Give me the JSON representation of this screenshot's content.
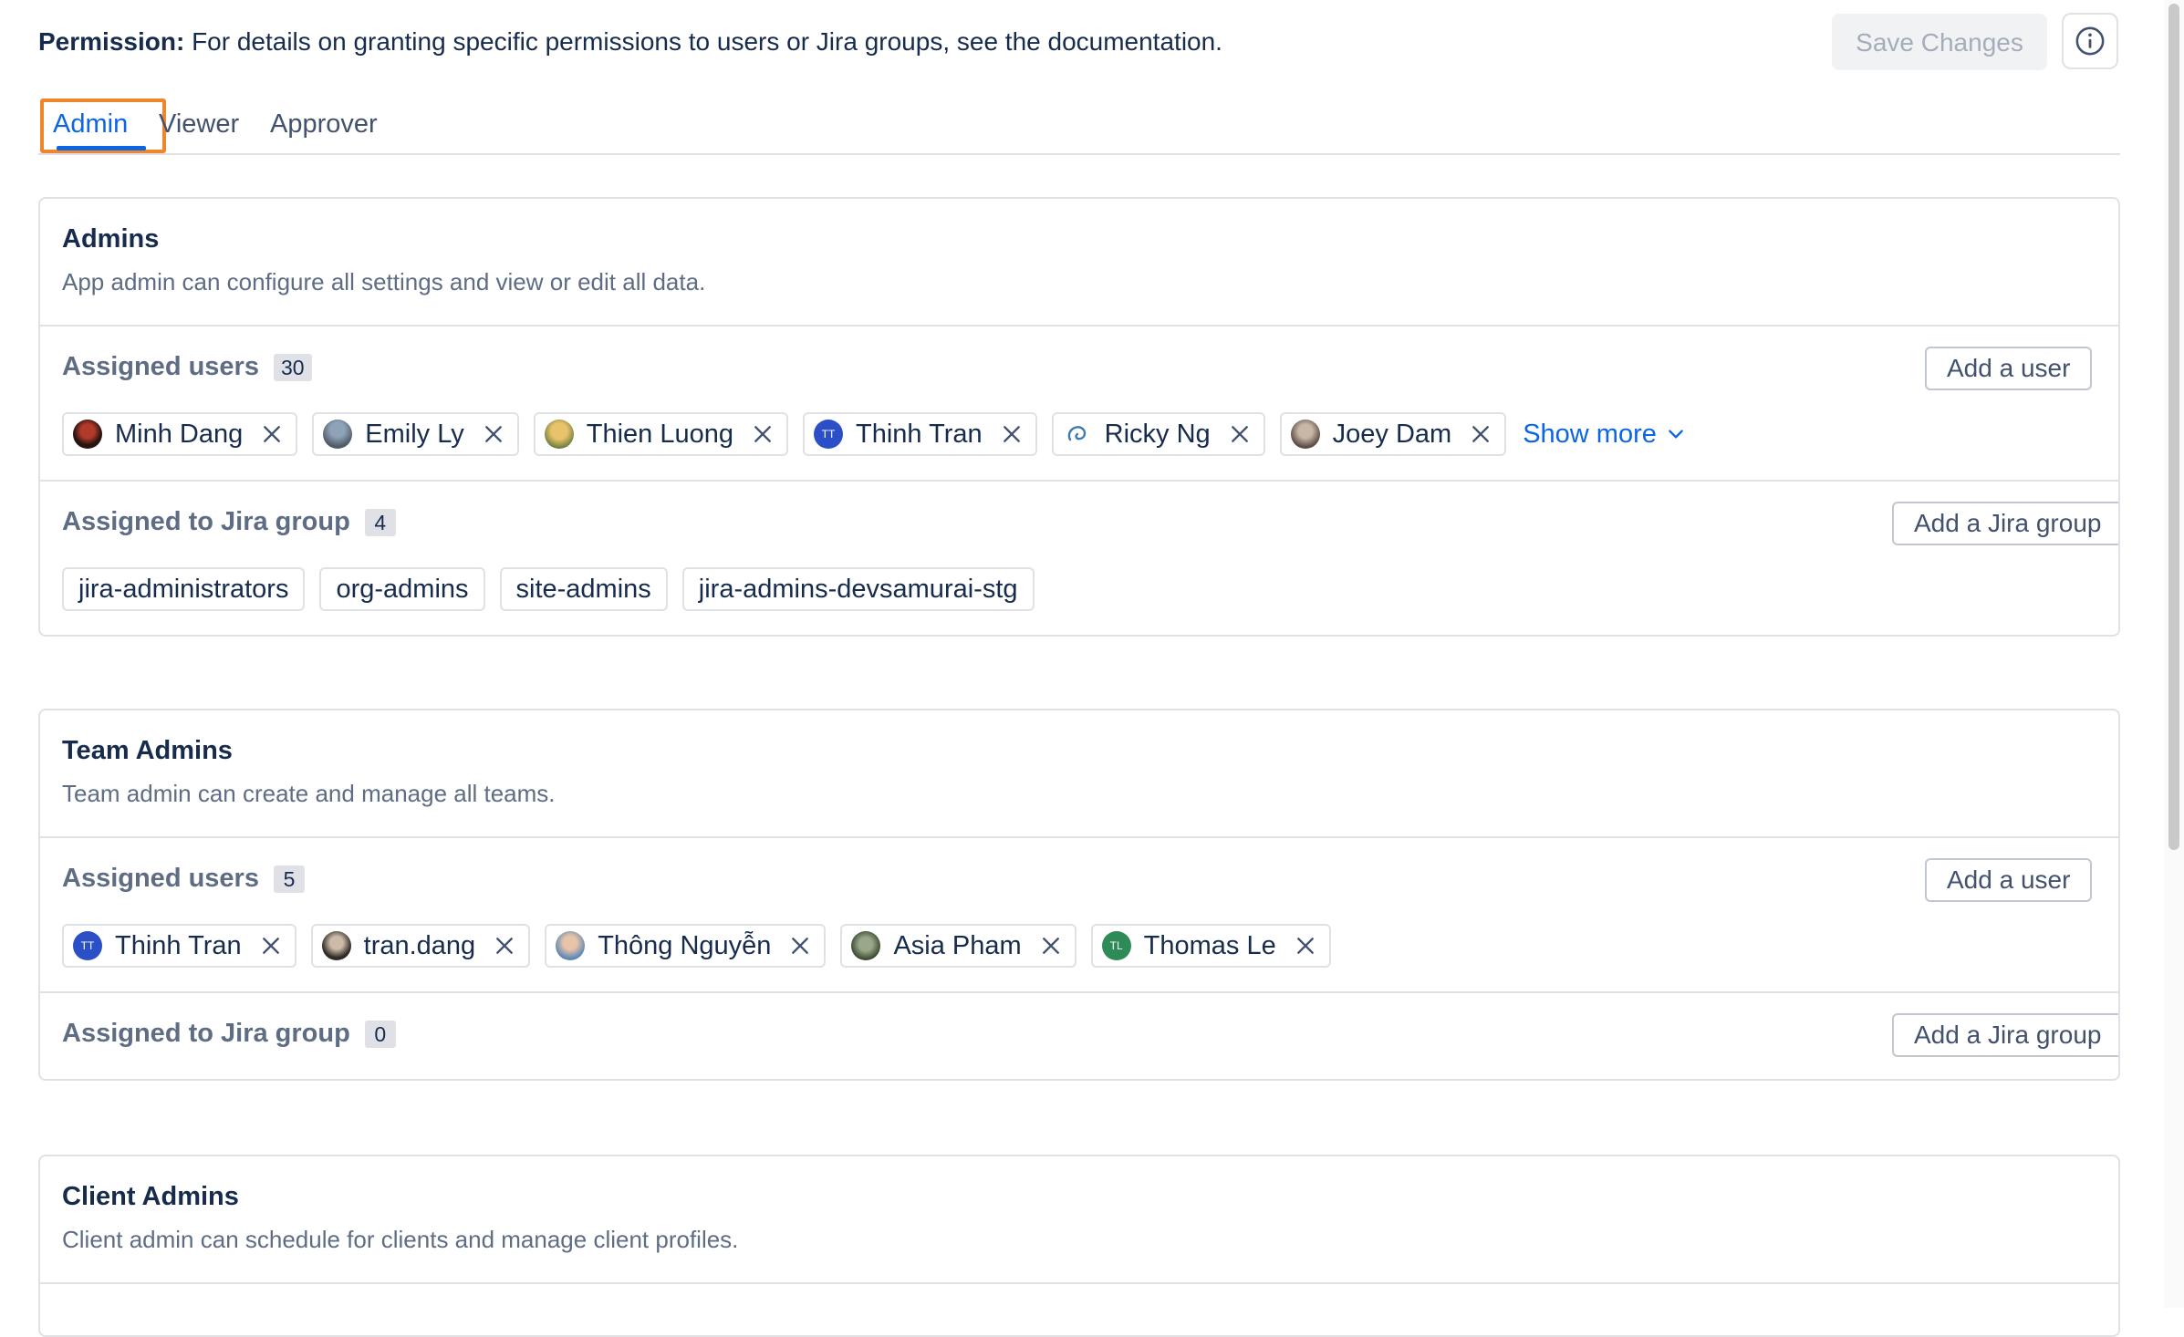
{
  "header": {
    "permission_label": "Permission:",
    "permission_text": "For details on granting specific permissions to users or Jira groups, see the documentation.",
    "save_label": "Save Changes",
    "info_icon": "info-circle-icon"
  },
  "tabs": [
    {
      "label": "Admin",
      "active": true
    },
    {
      "label": "Viewer",
      "active": false
    },
    {
      "label": "Approver",
      "active": false
    }
  ],
  "accent_color": "#0c66e4",
  "focus_color": "#f0862c",
  "cards": {
    "admins": {
      "title": "Admins",
      "description": "App admin can configure all settings and view or edit all data.",
      "users_label": "Assigned users",
      "users_count": "30",
      "add_user_label": "Add a user",
      "users": [
        "Minh Dang",
        "Emily Ly",
        "Thien Luong",
        "Thinh Tran",
        "Ricky Ng",
        "Joey Dam"
      ],
      "show_more_label": "Show more",
      "groups_label": "Assigned to Jira group",
      "groups_count": "4",
      "add_group_label": "Add a Jira group",
      "groups": [
        "jira-administrators",
        "org-admins",
        "site-admins",
        "jira-admins-devsamurai-stg"
      ]
    },
    "team_admins": {
      "title": "Team Admins",
      "description": "Team admin can create and manage all teams.",
      "users_label": "Assigned users",
      "users_count": "5",
      "add_user_label": "Add a user",
      "users": [
        "Thinh Tran",
        "tran.dang",
        "Thông Nguyễn",
        "Asia Pham",
        "Thomas Le"
      ],
      "groups_label": "Assigned to Jira group",
      "groups_count": "0",
      "add_group_label": "Add a Jira group"
    },
    "client_admins": {
      "title": "Client Admins",
      "description": "Client admin can schedule for clients and manage client profiles."
    }
  },
  "avatar_initials": {
    "thinh_tran": "TT",
    "thomas_le": "TL"
  }
}
